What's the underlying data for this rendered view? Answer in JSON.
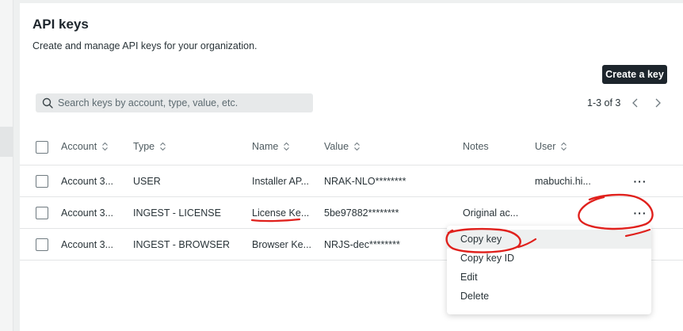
{
  "page": {
    "title": "API keys",
    "subtitle": "Create and manage API keys for your organization.",
    "create_button": "Create a key"
  },
  "search": {
    "placeholder": "Search keys by account, type, value, etc."
  },
  "pagination": {
    "label": "1-3 of 3"
  },
  "table": {
    "columns": [
      "Account",
      "Type",
      "Name",
      "Value",
      "Notes",
      "User"
    ],
    "rows": [
      {
        "account": "Account 3...",
        "type": "USER",
        "name": "Installer AP...",
        "value": "NRAK-NLO********",
        "notes": "",
        "user": "mabuchi.hi..."
      },
      {
        "account": "Account 3...",
        "type": "INGEST - LICENSE",
        "name": "License Ke...",
        "value": "5be97882********",
        "notes": "Original ac...",
        "user": ""
      },
      {
        "account": "Account 3...",
        "type": "INGEST - BROWSER",
        "name": "Browser Ke...",
        "value": "NRJS-dec********",
        "notes": "",
        "user": ""
      }
    ],
    "more_glyph": "···"
  },
  "context_menu": {
    "items": [
      "Copy key",
      "Copy key ID",
      "Edit",
      "Delete"
    ]
  },
  "colors": {
    "annotation": "#e0201c",
    "button_bg": "#1d252c",
    "search_bg": "#e7e9ea"
  }
}
